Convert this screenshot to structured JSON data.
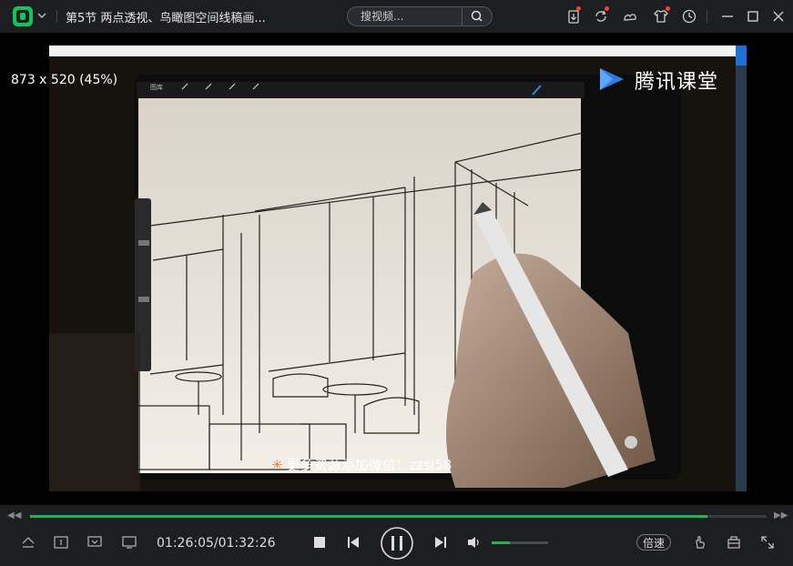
{
  "titlebar": {
    "title": "第5节 两点透视、鸟瞰图空间线稿画...",
    "search_placeholder": "搜视频..."
  },
  "video": {
    "resolution_info": "873 x 520 (45%)",
    "brand": "腾讯课堂",
    "watermark": "更多资源添加微信：zzsj58"
  },
  "controls": {
    "time": "01:26:05/01:32:26",
    "speed_label": "倍速",
    "progress": 0.92,
    "volume": 0.33
  },
  "icons": {
    "app_logo": "tencent-video-logo-icon",
    "brand_logo": "tencent-classroom-play-icon"
  },
  "colors": {
    "accent": "#25b34a",
    "logo": "#16c25a",
    "chrome": "#1d1e22",
    "notify": "#ff3b30"
  }
}
